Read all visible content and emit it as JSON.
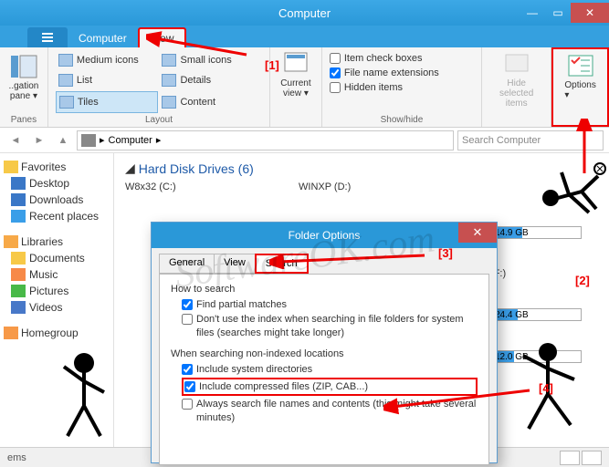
{
  "window": {
    "title": "Computer"
  },
  "tabs": {
    "file": "File",
    "computer": "Computer",
    "view": "View"
  },
  "ribbon": {
    "panes": {
      "label": "Panes",
      "item": "..gation\npane ▾"
    },
    "layout": {
      "label": "Layout",
      "medium": "Medium icons",
      "small": "Small icons",
      "list": "List",
      "details": "Details",
      "tiles": "Tiles",
      "content": "Content"
    },
    "curview": {
      "label": "Current\nview ▾"
    },
    "showhide": {
      "label": "Show/hide",
      "itemcheck": "Item check boxes",
      "ext": "File name extensions",
      "hidden": "Hidden items"
    },
    "hidesel": {
      "label": "Hide selected\nitems"
    },
    "options": {
      "label": "Options\n▾"
    }
  },
  "addr": {
    "crumb": "Computer",
    "search_placeholder": "Search Computer"
  },
  "sidebar": {
    "fav": "Favorites",
    "desktop": "Desktop",
    "downloads": "Downloads",
    "recent": "Recent places",
    "libs": "Libraries",
    "docs": "Documents",
    "music": "Music",
    "pics": "Pictures",
    "videos": "Videos",
    "home": "Homegroup"
  },
  "content": {
    "section": "Hard Disk Drives (6)",
    "drive1": "W8x32 (C:)",
    "drive2": "WINXP (D:)",
    "bar1": "14.9 GB",
    "bar2_label": "(F:)",
    "bar2": "24.4 GB",
    "bar3": "12.0 GB"
  },
  "status": {
    "text": "ems"
  },
  "dialog": {
    "title": "Folder Options",
    "tabs": {
      "general": "General",
      "view": "View",
      "search": "Search"
    },
    "howto": "How to search",
    "partial": "Find partial matches",
    "noindex": "Don't use the index when searching in file folders for system files (searches might take longer)",
    "when": "When searching non-indexed locations",
    "sysdirs": "Include system directories",
    "compressed": "Include compressed files (ZIP, CAB...)",
    "always": "Always search file names and contents (this might take several minutes)"
  },
  "annot": {
    "a1": "[1]",
    "a2": "[2]",
    "a3": "[3]",
    "a4": "[4]"
  },
  "watermark": "SoftwareOK.com"
}
